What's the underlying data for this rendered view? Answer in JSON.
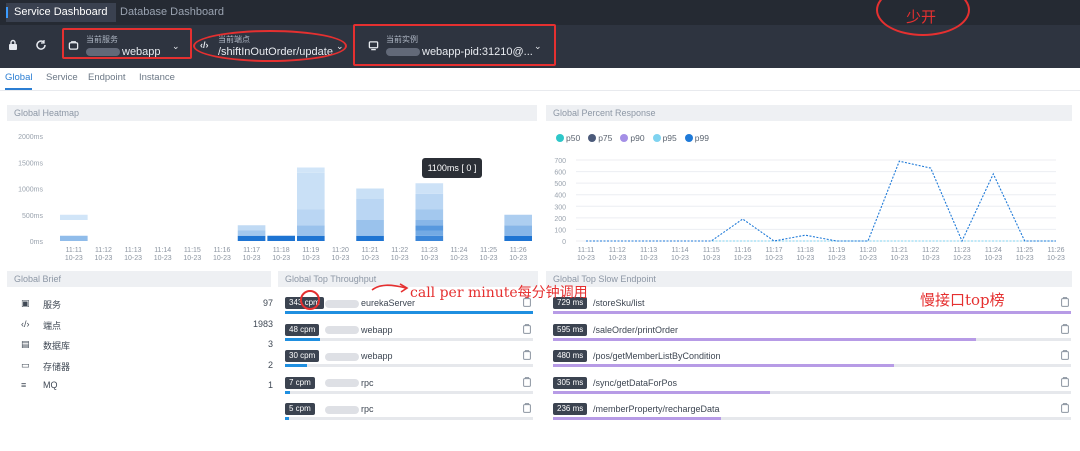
{
  "tabs": [
    {
      "label": "Service Dashboard",
      "active": true
    },
    {
      "label": "Database Dashboard",
      "active": false
    }
  ],
  "toolbar": {
    "service": {
      "caption": "当前服务",
      "value": "webapp"
    },
    "endpoint": {
      "caption": "当前端点",
      "value": "/shiftInOutOrder/update"
    },
    "instance": {
      "caption": "当前实例",
      "value": "webapp-pid:31210@..."
    }
  },
  "annotations": {
    "top_right": "少开",
    "cpm_note": "call per minute每分钟调用",
    "slow_note": "慢接口top榜"
  },
  "subtabs": [
    {
      "label": "Global",
      "active": true
    },
    {
      "label": "Service",
      "active": false
    },
    {
      "label": "Endpoint",
      "active": false
    },
    {
      "label": "Instance",
      "active": false
    }
  ],
  "panels": {
    "heatmap": "Global Heatmap",
    "percent": "Global Percent Response",
    "brief": "Global Brief",
    "throughput": "Global Top Throughput",
    "slow": "Global Top Slow Endpoint"
  },
  "x_ticks": [
    "11:11",
    "11:12",
    "11:13",
    "11:14",
    "11:15",
    "11:16",
    "11:17",
    "11:18",
    "11:19",
    "11:20",
    "11:21",
    "11:22",
    "11:23",
    "11:24",
    "11:25",
    "11:26"
  ],
  "x_date": "10-23",
  "heatmap_tooltip": "1100ms [ 0 ]",
  "chart_data": [
    {
      "type": "heatmap",
      "title": "Global Heatmap",
      "y_ticks": [
        "2000ms",
        "1500ms",
        "1000ms",
        "500ms",
        "0ms"
      ],
      "ylim": [
        0,
        2000
      ],
      "x": [
        "11:11",
        "11:12",
        "11:13",
        "11:14",
        "11:15",
        "11:16",
        "11:17",
        "11:18",
        "11:19",
        "11:20",
        "11:21",
        "11:22",
        "11:23",
        "11:24",
        "11:25",
        "11:26"
      ],
      "columns": [
        {
          "x": "11:11",
          "cells": [
            [
              0,
              100,
              0.4
            ],
            [
              400,
              500,
              0.06
            ]
          ]
        },
        {
          "x": "11:17",
          "cells": [
            [
              0,
              100,
              1
            ],
            [
              100,
              200,
              0.3
            ],
            [
              200,
              300,
              0.15
            ]
          ]
        },
        {
          "x": "11:18",
          "cells": [
            [
              0,
              100,
              1
            ]
          ]
        },
        {
          "x": "11:19",
          "cells": [
            [
              0,
              100,
              1
            ],
            [
              100,
              300,
              0.35
            ],
            [
              300,
              600,
              0.18
            ],
            [
              600,
              1300,
              0.1
            ],
            [
              1300,
              1400,
              0.06
            ]
          ]
        },
        {
          "x": "11:21",
          "cells": [
            [
              0,
              100,
              1
            ],
            [
              100,
              400,
              0.35
            ],
            [
              400,
              800,
              0.18
            ],
            [
              800,
              1000,
              0.1
            ]
          ]
        },
        {
          "x": "11:23",
          "cells": [
            [
              0,
              100,
              0.85
            ],
            [
              100,
              200,
              0.55
            ],
            [
              200,
              300,
              0.7
            ],
            [
              300,
              400,
              0.45
            ],
            [
              400,
              600,
              0.3
            ],
            [
              600,
              900,
              0.18
            ],
            [
              900,
              1100,
              0.08
            ]
          ]
        },
        {
          "x": "11:26",
          "cells": [
            [
              0,
              100,
              1
            ],
            [
              100,
              300,
              0.45
            ],
            [
              300,
              500,
              0.25
            ]
          ]
        }
      ]
    },
    {
      "type": "line",
      "title": "Global Percent Response",
      "legend": [
        "p50",
        "p75",
        "p90",
        "p95",
        "p99"
      ],
      "legend_colors": [
        "#2ec7c9",
        "#4b5a7a",
        "#a48fe6",
        "#7fd3f0",
        "#1f7ad8"
      ],
      "y_ticks": [
        0,
        100,
        200,
        300,
        400,
        500,
        600,
        700
      ],
      "ylim": [
        0,
        700
      ],
      "categories": [
        "11:11",
        "11:12",
        "11:13",
        "11:14",
        "11:15",
        "11:16",
        "11:17",
        "11:18",
        "11:19",
        "11:20",
        "11:21",
        "11:22",
        "11:23",
        "11:24",
        "11:25",
        "11:26"
      ],
      "series": [
        {
          "name": "p99",
          "values": [
            0,
            0,
            0,
            0,
            0,
            190,
            0,
            50,
            0,
            0,
            690,
            630,
            0,
            580,
            0,
            0
          ]
        },
        {
          "name": "p95",
          "values": [
            0,
            0,
            0,
            0,
            0,
            0,
            0,
            0,
            0,
            0,
            0,
            0,
            0,
            0,
            0,
            0
          ]
        },
        {
          "name": "p90",
          "values": [
            0,
            0,
            0,
            0,
            0,
            0,
            0,
            0,
            0,
            0,
            0,
            0,
            0,
            0,
            0,
            0
          ]
        },
        {
          "name": "p75",
          "values": [
            0,
            0,
            0,
            0,
            0,
            0,
            0,
            0,
            0,
            0,
            0,
            0,
            0,
            0,
            0,
            0
          ]
        },
        {
          "name": "p50",
          "values": [
            0,
            0,
            0,
            0,
            0,
            0,
            0,
            0,
            0,
            0,
            0,
            0,
            0,
            0,
            0,
            0
          ]
        }
      ]
    }
  ],
  "brief": [
    {
      "icon": "server-icon",
      "glyph": "▣",
      "label": "服务",
      "count": "97"
    },
    {
      "icon": "code-icon",
      "glyph": "‹/›",
      "label": "端点",
      "count": "1983"
    },
    {
      "icon": "database-icon",
      "glyph": "▤",
      "label": "数据库",
      "count": "3"
    },
    {
      "icon": "storage-icon",
      "glyph": "▭",
      "label": "存储器",
      "count": "2"
    },
    {
      "icon": "mq-icon",
      "glyph": "≡",
      "label": "MQ",
      "count": "1"
    }
  ],
  "throughput": [
    {
      "value": "343 cpm",
      "name": "eurekaServer",
      "fraction": 1.0
    },
    {
      "value": "48 cpm",
      "name": "webapp",
      "fraction": 0.14
    },
    {
      "value": "30 cpm",
      "name": "webapp",
      "fraction": 0.09
    },
    {
      "value": "7 cpm",
      "name": "rpc",
      "fraction": 0.02
    },
    {
      "value": "5 cpm",
      "name": "rpc",
      "fraction": 0.015
    }
  ],
  "slow": [
    {
      "value": "729 ms",
      "name": "/storeSku/list",
      "fraction": 1.0
    },
    {
      "value": "595 ms",
      "name": "/saleOrder/printOrder",
      "fraction": 0.816
    },
    {
      "value": "480 ms",
      "name": "/pos/getMemberListByCondition",
      "fraction": 0.658
    },
    {
      "value": "305 ms",
      "name": "/sync/getDataForPos",
      "fraction": 0.418
    },
    {
      "value": "236 ms",
      "name": "/memberProperty/rechargeData",
      "fraction": 0.324
    }
  ],
  "colors": {
    "accent": "#2b7ed3",
    "throughput_bar": "#1f8fe0",
    "slow_bar": "#b79be6",
    "annotation": "#e53030"
  }
}
